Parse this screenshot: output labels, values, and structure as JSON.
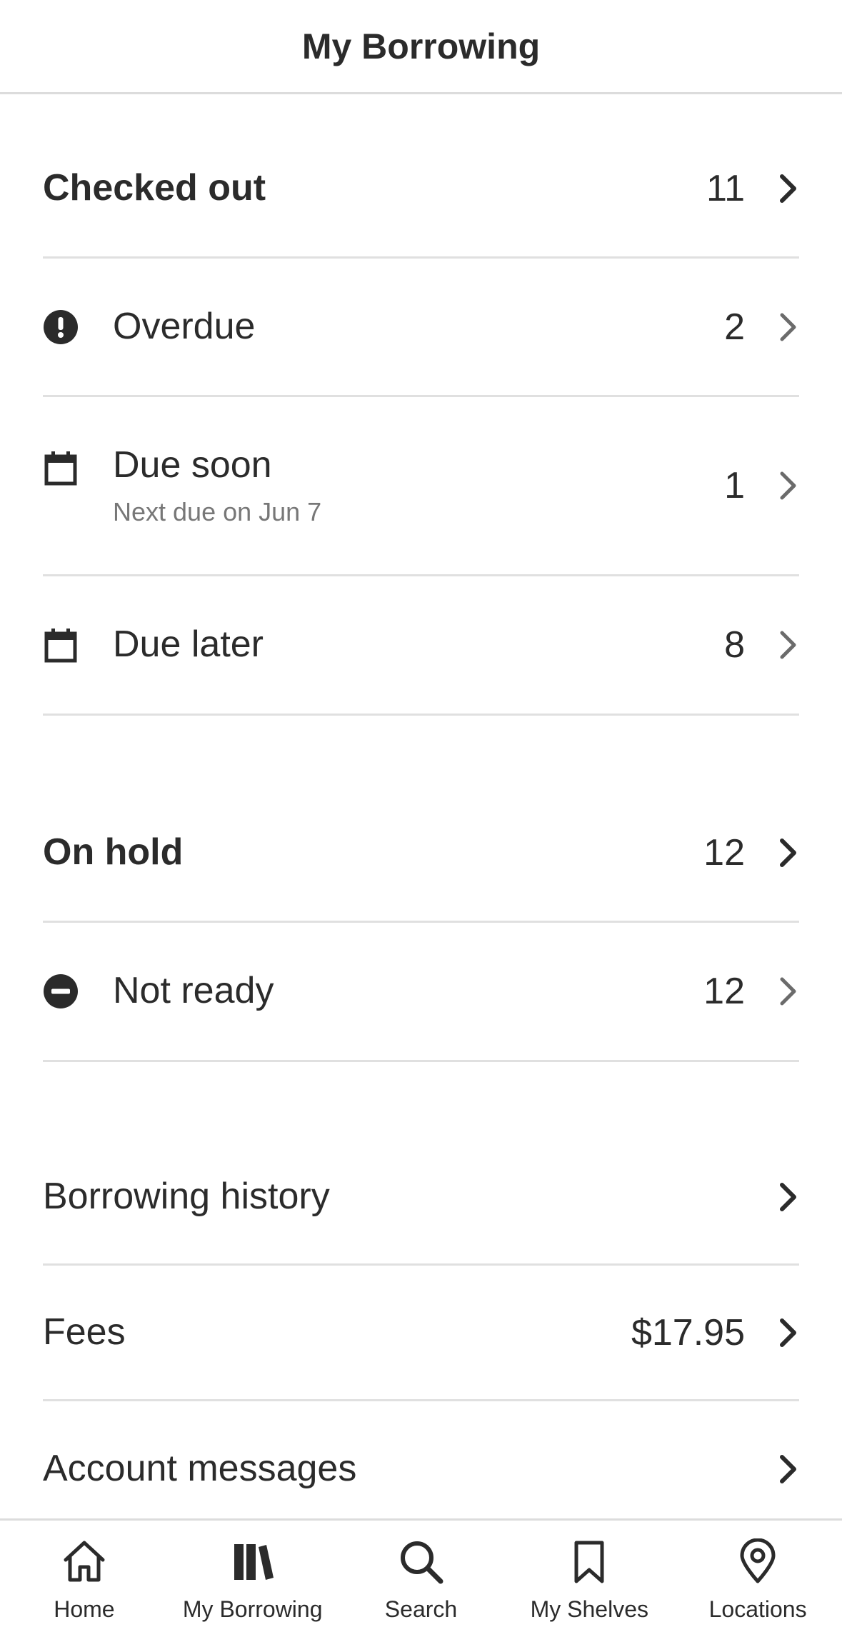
{
  "header": {
    "title": "My Borrowing"
  },
  "checked_out": {
    "label": "Checked out",
    "count": "11",
    "items": [
      {
        "icon": "exclamation-circle-icon",
        "label": "Overdue",
        "count": "2"
      },
      {
        "icon": "calendar-icon",
        "label": "Due soon",
        "sub": "Next due on Jun 7",
        "count": "1"
      },
      {
        "icon": "calendar-icon",
        "label": "Due later",
        "count": "8"
      }
    ]
  },
  "on_hold": {
    "label": "On hold",
    "count": "12",
    "items": [
      {
        "icon": "minus-circle-icon",
        "label": "Not ready",
        "count": "12"
      }
    ]
  },
  "account": {
    "history_label": "Borrowing history",
    "fees_label": "Fees",
    "fees_value": "$17.95",
    "messages_label": "Account messages"
  },
  "tabbar": {
    "tabs": [
      {
        "label": "Home",
        "icon": "home-icon"
      },
      {
        "label": "My Borrowing",
        "icon": "books-icon",
        "active": true
      },
      {
        "label": "Search",
        "icon": "search-icon"
      },
      {
        "label": "My Shelves",
        "icon": "bookmark-icon"
      },
      {
        "label": "Locations",
        "icon": "location-pin-icon"
      }
    ]
  },
  "colors": {
    "text": "#2b2b2b",
    "subtext": "#777777",
    "divider": "#e0e0e0",
    "chevron_strong": "#2b2b2b",
    "chevron_muted": "#6b6b6b"
  }
}
